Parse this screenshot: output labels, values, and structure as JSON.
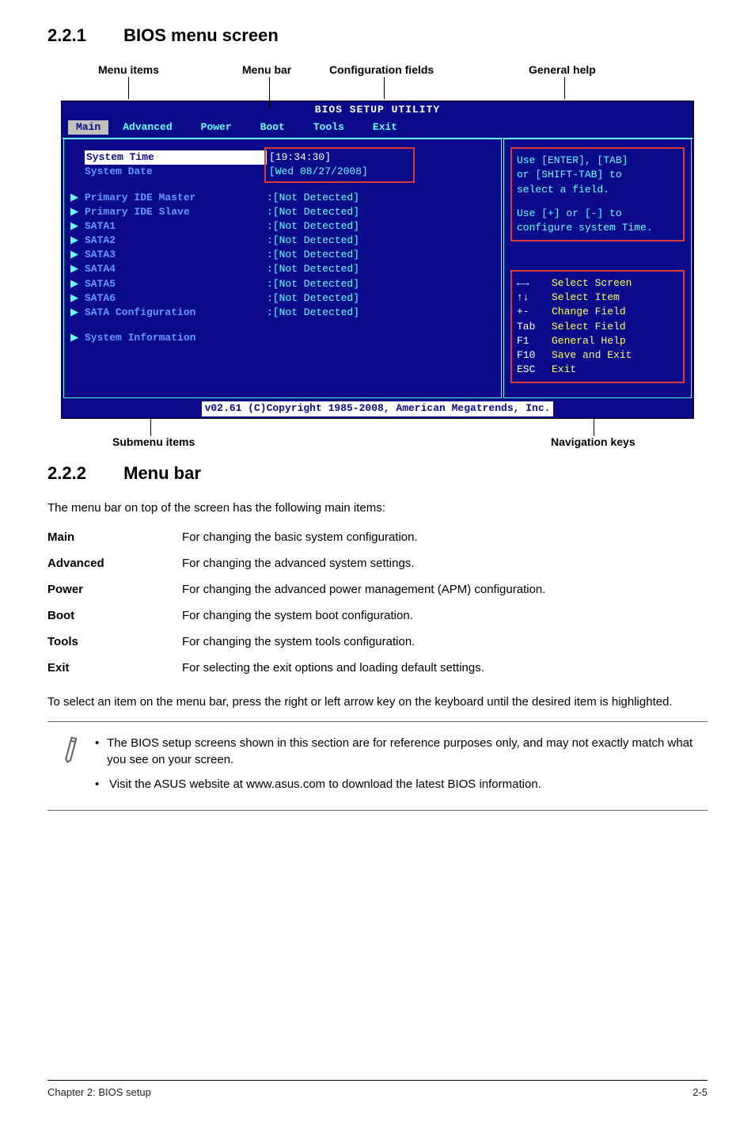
{
  "section1": {
    "num": "2.2.1",
    "title": "BIOS menu screen"
  },
  "topLabels": {
    "menuItems": "Menu items",
    "menuBar": "Menu bar",
    "configFields": "Configuration fields",
    "generalHelp": "General help"
  },
  "bios": {
    "titlebar": "BIOS SETUP UTILITY",
    "tabs": {
      "main": "Main",
      "advanced": "Advanced",
      "power": "Power",
      "boot": "Boot",
      "tools": "Tools",
      "exit": "Exit"
    },
    "left": {
      "systemTime": {
        "label": "System Time",
        "value": "[19:34:30]"
      },
      "systemDate": {
        "label": "System Date",
        "value": "[Wed 08/27/2008]"
      },
      "rows": [
        {
          "label": "Primary IDE Master",
          "value": ":[Not Detected]"
        },
        {
          "label": "Primary IDE Slave",
          "value": ":[Not Detected]"
        },
        {
          "label": "SATA1",
          "value": ":[Not Detected]"
        },
        {
          "label": "SATA2",
          "value": ":[Not Detected]"
        },
        {
          "label": "SATA3",
          "value": ":[Not Detected]"
        },
        {
          "label": "SATA4",
          "value": ":[Not Detected]"
        },
        {
          "label": "SATA5",
          "value": ":[Not Detected]"
        },
        {
          "label": "SATA6",
          "value": ":[Not Detected]"
        },
        {
          "label": "SATA Configuration",
          "value": ":[Not Detected]"
        }
      ],
      "sysInfo": "System Information"
    },
    "help": {
      "l1": "Use [ENTER], [TAB]",
      "l2": "or [SHIFT-TAB] to",
      "l3": "select a field.",
      "l4": "Use [+] or [-] to",
      "l5": "configure system Time."
    },
    "nav": {
      "r1k": "←→",
      "r1d": "Select Screen",
      "r2k": "↑↓",
      "r2d": "Select Item",
      "r3k": "+-",
      "r3d": "Change Field",
      "r4k": "Tab",
      "r4d": "Select Field",
      "r5k": "F1",
      "r5d": "General Help",
      "r6k": "F10",
      "r6d": "Save and Exit",
      "r7k": "ESC",
      "r7d": "Exit"
    },
    "footer": "v02.61 (C)Copyright 1985-2008, American Megatrends, Inc."
  },
  "bottomLabels": {
    "submenu": "Submenu items",
    "navkeys": "Navigation keys"
  },
  "section2": {
    "num": "2.2.2",
    "title": "Menu bar"
  },
  "menubarIntro": "The menu bar on top of the screen has the following main items:",
  "defs": {
    "main": {
      "t": "Main",
      "d": "For changing the basic system configuration."
    },
    "advanced": {
      "t": "Advanced",
      "d": "For changing the advanced system settings."
    },
    "power": {
      "t": "Power",
      "d": "For changing the advanced power management (APM) configuration."
    },
    "boot": {
      "t": "Boot",
      "d": "For changing the system boot configuration."
    },
    "tools": {
      "t": "Tools",
      "d": "For changing the system tools configuration."
    },
    "exit": {
      "t": "Exit",
      "d": "For selecting the exit options and loading default settings."
    }
  },
  "selectText": "To select an item on the menu bar, press the right or left arrow key on the keyboard until the desired item is highlighted.",
  "notes": {
    "n1": "The BIOS setup screens shown in this section are for reference purposes only, and may not exactly match what you see on your screen.",
    "n2": "Visit the ASUS website at www.asus.com to download the latest BIOS information."
  },
  "footer": {
    "left": "Chapter 2: BIOS setup",
    "right": "2-5"
  }
}
